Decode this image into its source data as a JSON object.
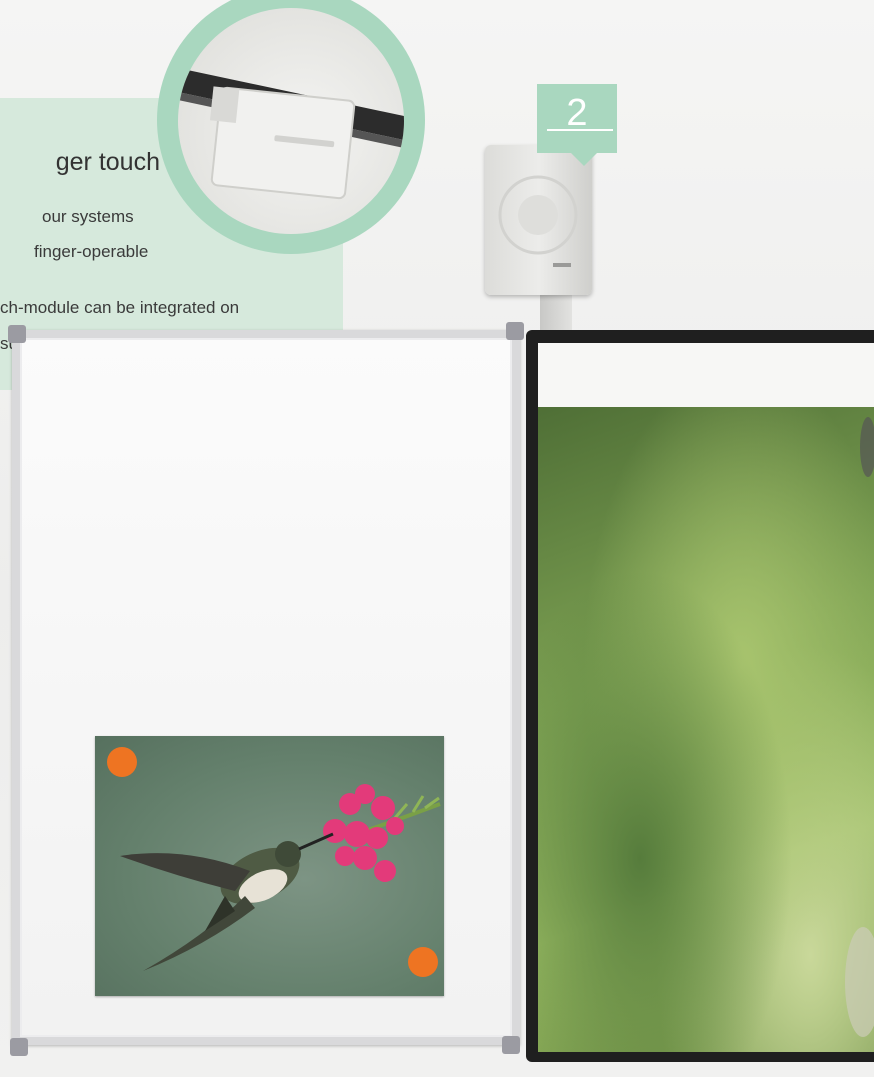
{
  "info": {
    "title": "ger touch",
    "lines": [
      "our systems",
      "finger-operable",
      "ch-module can be integrated on",
      "surface."
    ]
  },
  "badge": {
    "number": "2"
  },
  "colors": {
    "accent_green": "#a9d7bf",
    "info_background": "#d6e9dc",
    "magnet_orange": "#ee7422",
    "screen_frame": "#1f1f1f"
  },
  "icons": {
    "touch_module": "touch-module-icon",
    "speaker": "speaker-icon",
    "hummingbird": "hummingbird-icon"
  }
}
